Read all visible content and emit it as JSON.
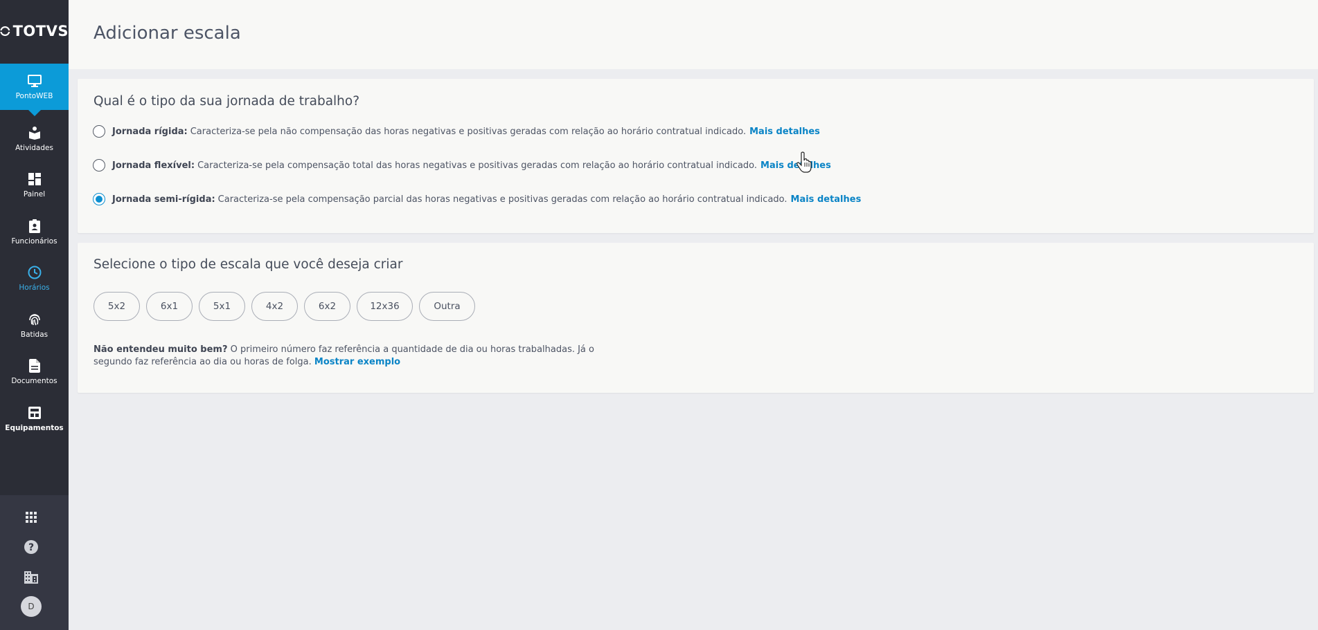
{
  "brand": {
    "name": "TOTVS"
  },
  "sidebar": {
    "items": [
      {
        "label": "PontoWEB",
        "icon": "monitor-icon"
      },
      {
        "label": "Atividades",
        "icon": "activities-icon"
      },
      {
        "label": "Painel",
        "icon": "dashboard-icon"
      },
      {
        "label": "Funcionários",
        "icon": "badge-icon"
      },
      {
        "label": "Horários",
        "icon": "clock-icon"
      },
      {
        "label": "Batidas",
        "icon": "fingerprint-icon"
      },
      {
        "label": "Documentos",
        "icon": "document-icon"
      },
      {
        "label": "Equipamentos",
        "icon": "device-icon"
      }
    ],
    "bottom": {
      "apps_icon": "apps-grid-icon",
      "help_icon": "help-icon",
      "company_icon": "building-icon",
      "avatar_initial": "D"
    }
  },
  "header": {
    "title": "Adicionar escala"
  },
  "journey": {
    "title": "Qual é o tipo da sua jornada de trabalho?",
    "options": [
      {
        "name": "Jornada rígida:",
        "description": "Caracteriza-se pela não compensação das horas negativas e positivas geradas com relação ao horário contratual indicado.",
        "link": "Mais detalhes",
        "checked": false
      },
      {
        "name": "Jornada flexível:",
        "description": "Caracteriza-se pela compensação total das horas negativas e positivas geradas com relação ao horário contratual indicado.",
        "link": "Mais detalhes",
        "checked": false
      },
      {
        "name": "Jornada semi-rígida:",
        "description": "Caracteriza-se pela compensação parcial das horas negativas e positivas geradas com relação ao horário contratual indicado.",
        "link": "Mais detalhes",
        "checked": true
      }
    ]
  },
  "scale": {
    "title": "Selecione o tipo de escala que você deseja criar",
    "options": [
      "5x2",
      "6x1",
      "5x1",
      "4x2",
      "6x2",
      "12x36",
      "Outra"
    ],
    "help_bold": "Não entendeu muito bem?",
    "help_text": "O primeiro número faz referência a quantidade de dia ou horas trabalhadas. Já o segundo faz referência ao dia ou horas de folga.",
    "help_link": "Mostrar exemplo"
  },
  "colors": {
    "sidebar_bg": "#2b2d36",
    "accent": "#0c9bd8",
    "link": "#0a84c6",
    "selected_nav": "#3ab1ea"
  }
}
